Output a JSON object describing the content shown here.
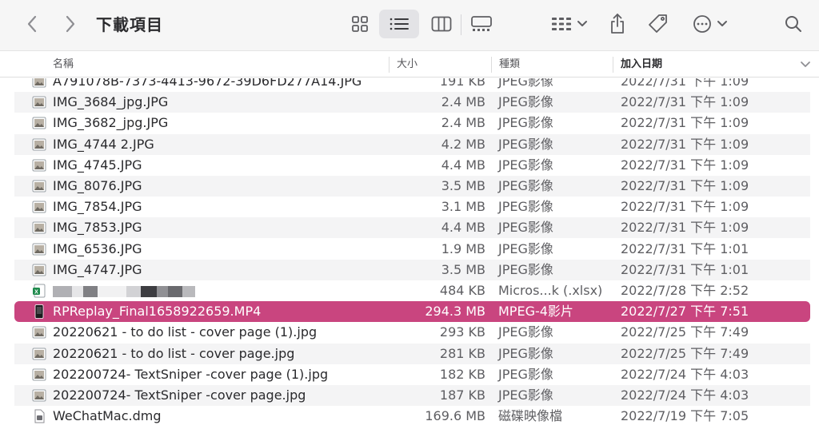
{
  "window": {
    "title": "下載項目"
  },
  "toolbar": {
    "icons": [
      "chevron-left-icon",
      "chevron-right-icon",
      "grid-view-icon",
      "list-view-icon",
      "column-view-icon",
      "gallery-view-icon",
      "group-icon",
      "share-icon",
      "tag-icon",
      "more-icon",
      "search-icon"
    ]
  },
  "columns": {
    "name": "名稱",
    "size": "大小",
    "kind": "種類",
    "date": "加入日期"
  },
  "colors": {
    "selection": "#c9457f",
    "alt_row": "#f4f4f5"
  },
  "files": [
    {
      "name": "A791078B-7373-4413-9672-39D6FD277A14.JPG",
      "size": "191 KB",
      "kind": "JPEG影像",
      "date": "2022/7/31 下午 1:09",
      "icon": "image-file-icon",
      "partial": true
    },
    {
      "name": "IMG_3684_jpg.JPG",
      "size": "2.4 MB",
      "kind": "JPEG影像",
      "date": "2022/7/31 下午 1:09",
      "icon": "image-file-icon"
    },
    {
      "name": "IMG_3682_jpg.JPG",
      "size": "2.4 MB",
      "kind": "JPEG影像",
      "date": "2022/7/31 下午 1:09",
      "icon": "image-file-icon"
    },
    {
      "name": "IMG_4744 2.JPG",
      "size": "4.2 MB",
      "kind": "JPEG影像",
      "date": "2022/7/31 下午 1:09",
      "icon": "image-file-icon"
    },
    {
      "name": "IMG_4745.JPG",
      "size": "4.4 MB",
      "kind": "JPEG影像",
      "date": "2022/7/31 下午 1:09",
      "icon": "image-file-icon"
    },
    {
      "name": "IMG_8076.JPG",
      "size": "3.5 MB",
      "kind": "JPEG影像",
      "date": "2022/7/31 下午 1:09",
      "icon": "image-file-icon"
    },
    {
      "name": "IMG_7854.JPG",
      "size": "3.1 MB",
      "kind": "JPEG影像",
      "date": "2022/7/31 下午 1:09",
      "icon": "image-file-icon"
    },
    {
      "name": "IMG_7853.JPG",
      "size": "4.4 MB",
      "kind": "JPEG影像",
      "date": "2022/7/31 下午 1:09",
      "icon": "image-file-icon"
    },
    {
      "name": "IMG_6536.JPG",
      "size": "1.9 MB",
      "kind": "JPEG影像",
      "date": "2022/7/31 下午 1:01",
      "icon": "image-file-icon"
    },
    {
      "name": "IMG_4747.JPG",
      "size": "3.5 MB",
      "kind": "JPEG影像",
      "date": "2022/7/31 下午 1:01",
      "icon": "image-file-icon"
    },
    {
      "name": "",
      "size": "484 KB",
      "kind": "Micros...k (.xlsx)",
      "date": "2022/7/28 下午 2:52",
      "icon": "excel-file-icon",
      "redacted": true
    },
    {
      "name": "RPReplay_Final1658922659.MP4",
      "size": "294.3 MB",
      "kind": "MPEG-4影片",
      "date": "2022/7/27 下午 7:51",
      "icon": "video-file-icon",
      "selected": true
    },
    {
      "name": "20220621 - to do list - cover page (1).jpg",
      "size": "293 KB",
      "kind": "JPEG影像",
      "date": "2022/7/25 下午 7:49",
      "icon": "image-file-icon"
    },
    {
      "name": "20220621 - to do list - cover page.jpg",
      "size": "281 KB",
      "kind": "JPEG影像",
      "date": "2022/7/25 下午 7:49",
      "icon": "image-file-icon"
    },
    {
      "name": "202200724- TextSniper -cover page (1).jpg",
      "size": "182 KB",
      "kind": "JPEG影像",
      "date": "2022/7/24 下午 4:03",
      "icon": "image-file-icon"
    },
    {
      "name": "202200724- TextSniper -cover page.jpg",
      "size": "187 KB",
      "kind": "JPEG影像",
      "date": "2022/7/24 下午 4:03",
      "icon": "image-file-icon"
    },
    {
      "name": "WeChatMac.dmg",
      "size": "169.6 MB",
      "kind": "磁碟映像檔",
      "date": "2022/7/19 下午 7:05",
      "icon": "disk-image-icon"
    }
  ]
}
